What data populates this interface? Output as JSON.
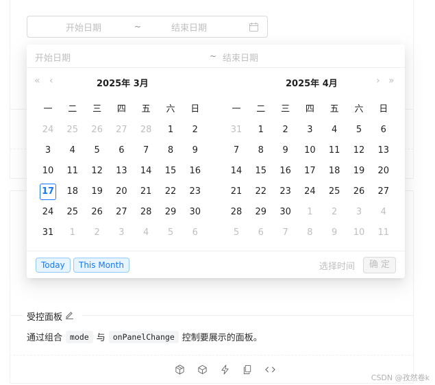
{
  "range_input": {
    "start_placeholder": "开始日期",
    "separator": "~",
    "end_placeholder": "结束日期"
  },
  "panel": {
    "start_placeholder": "开始日期",
    "separator": "~",
    "end_placeholder": "结束日期",
    "nav": {
      "super_prev": "«",
      "prev": "‹",
      "next": "›",
      "super_next": "»"
    },
    "left": {
      "title": "2025年 3月",
      "weekdays": [
        "一",
        "二",
        "三",
        "四",
        "五",
        "六",
        "日"
      ],
      "weeks": [
        [
          {
            "d": "24",
            "out": true
          },
          {
            "d": "25",
            "out": true
          },
          {
            "d": "26",
            "out": true
          },
          {
            "d": "27",
            "out": true
          },
          {
            "d": "28",
            "out": true
          },
          {
            "d": "1"
          },
          {
            "d": "2"
          }
        ],
        [
          {
            "d": "3"
          },
          {
            "d": "4"
          },
          {
            "d": "5"
          },
          {
            "d": "6"
          },
          {
            "d": "7"
          },
          {
            "d": "8"
          },
          {
            "d": "9"
          }
        ],
        [
          {
            "d": "10"
          },
          {
            "d": "11"
          },
          {
            "d": "12"
          },
          {
            "d": "13"
          },
          {
            "d": "14"
          },
          {
            "d": "15"
          },
          {
            "d": "16"
          }
        ],
        [
          {
            "d": "17",
            "today": true
          },
          {
            "d": "18"
          },
          {
            "d": "19"
          },
          {
            "d": "20"
          },
          {
            "d": "21"
          },
          {
            "d": "22"
          },
          {
            "d": "23"
          }
        ],
        [
          {
            "d": "24"
          },
          {
            "d": "25"
          },
          {
            "d": "26"
          },
          {
            "d": "27"
          },
          {
            "d": "28"
          },
          {
            "d": "29"
          },
          {
            "d": "30"
          }
        ],
        [
          {
            "d": "31"
          },
          {
            "d": "1",
            "out": true
          },
          {
            "d": "2",
            "out": true
          },
          {
            "d": "3",
            "out": true
          },
          {
            "d": "4",
            "out": true
          },
          {
            "d": "5",
            "out": true
          },
          {
            "d": "6",
            "out": true
          }
        ]
      ]
    },
    "right": {
      "title": "2025年 4月",
      "weekdays": [
        "一",
        "二",
        "三",
        "四",
        "五",
        "六",
        "日"
      ],
      "weeks": [
        [
          {
            "d": "31",
            "out": true
          },
          {
            "d": "1"
          },
          {
            "d": "2"
          },
          {
            "d": "3"
          },
          {
            "d": "4"
          },
          {
            "d": "5"
          },
          {
            "d": "6"
          }
        ],
        [
          {
            "d": "7"
          },
          {
            "d": "8"
          },
          {
            "d": "9"
          },
          {
            "d": "10"
          },
          {
            "d": "11"
          },
          {
            "d": "12"
          },
          {
            "d": "13"
          }
        ],
        [
          {
            "d": "14"
          },
          {
            "d": "15"
          },
          {
            "d": "16"
          },
          {
            "d": "17"
          },
          {
            "d": "18"
          },
          {
            "d": "19"
          },
          {
            "d": "20"
          }
        ],
        [
          {
            "d": "21"
          },
          {
            "d": "22"
          },
          {
            "d": "23"
          },
          {
            "d": "24"
          },
          {
            "d": "25"
          },
          {
            "d": "26"
          },
          {
            "d": "27"
          }
        ],
        [
          {
            "d": "28"
          },
          {
            "d": "29"
          },
          {
            "d": "30"
          },
          {
            "d": "1",
            "out": true
          },
          {
            "d": "2",
            "out": true
          },
          {
            "d": "3",
            "out": true
          },
          {
            "d": "4",
            "out": true
          }
        ],
        [
          {
            "d": "5",
            "out": true
          },
          {
            "d": "6",
            "out": true
          },
          {
            "d": "7",
            "out": true
          },
          {
            "d": "8",
            "out": true
          },
          {
            "d": "9",
            "out": true
          },
          {
            "d": "10",
            "out": true
          },
          {
            "d": "11",
            "out": true
          }
        ]
      ]
    },
    "footer": {
      "today_label": "Today",
      "this_month_label": "This Month",
      "select_time_label": "选择时间",
      "ok_label": "确 定"
    }
  },
  "description": {
    "title": "受控面板",
    "text_before": "通过组合",
    "code1": "mode",
    "text_mid": "与",
    "code2": "onPanelChange",
    "text_after": "控制要展示的面板。"
  },
  "actions": [
    "codesandbox-icon",
    "codepen-icon",
    "stackblitz-icon",
    "copy-icon",
    "expand-code-icon"
  ],
  "watermark": "CSDN @孜然卷k",
  "colors": {
    "primary": "#1677ff",
    "disabled": "#bfbfbf",
    "tag_bg": "#e6f4ff",
    "tag_border": "#91caff"
  }
}
